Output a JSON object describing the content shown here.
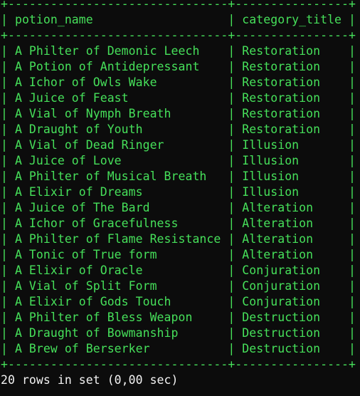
{
  "terminal": {
    "border_top": "+-------------------------------+----------------+",
    "header": "| potion_name                   | category_title |",
    "border_mid": "+-------------------------------+----------------+",
    "rows": [
      "| A Philter of Demonic Leech    | Restoration    |",
      "| A Potion of Antidepressant    | Restoration    |",
      "| A Ichor of Owls Wake          | Restoration    |",
      "| A Juice of Feast              | Restoration    |",
      "| A Vial of Nymph Breath        | Restoration    |",
      "| A Draught of Youth            | Restoration    |",
      "| A Vial of Dead Ringer         | Illusion       |",
      "| A Juice of Love               | Illusion       |",
      "| A Philter of Musical Breath   | Illusion       |",
      "| A Elixir of Dreams            | Illusion       |",
      "| A Juice of The Bard           | Alteration     |",
      "| A Ichor of Gracefulness       | Alteration     |",
      "| A Philter of Flame Resistance | Alteration     |",
      "| A Tonic of True form          | Alteration     |",
      "| A Elixir of Oracle            | Conjuration    |",
      "| A Vial of Split Form          | Conjuration    |",
      "| A Elixir of Gods Touch        | Conjuration    |",
      "| A Philter of Bless Weapon     | Destruction    |",
      "| A Draught of Bowmanship       | Destruction    |",
      "| A Brew of Berserker           | Destruction    |"
    ],
    "border_bottom": "+-------------------------------+----------------+",
    "footer": "20 rows in set (0,00 sec)",
    "text_color": "#46e05a",
    "footer_color": "#f2f2f2",
    "background": "#0c0c0c"
  }
}
